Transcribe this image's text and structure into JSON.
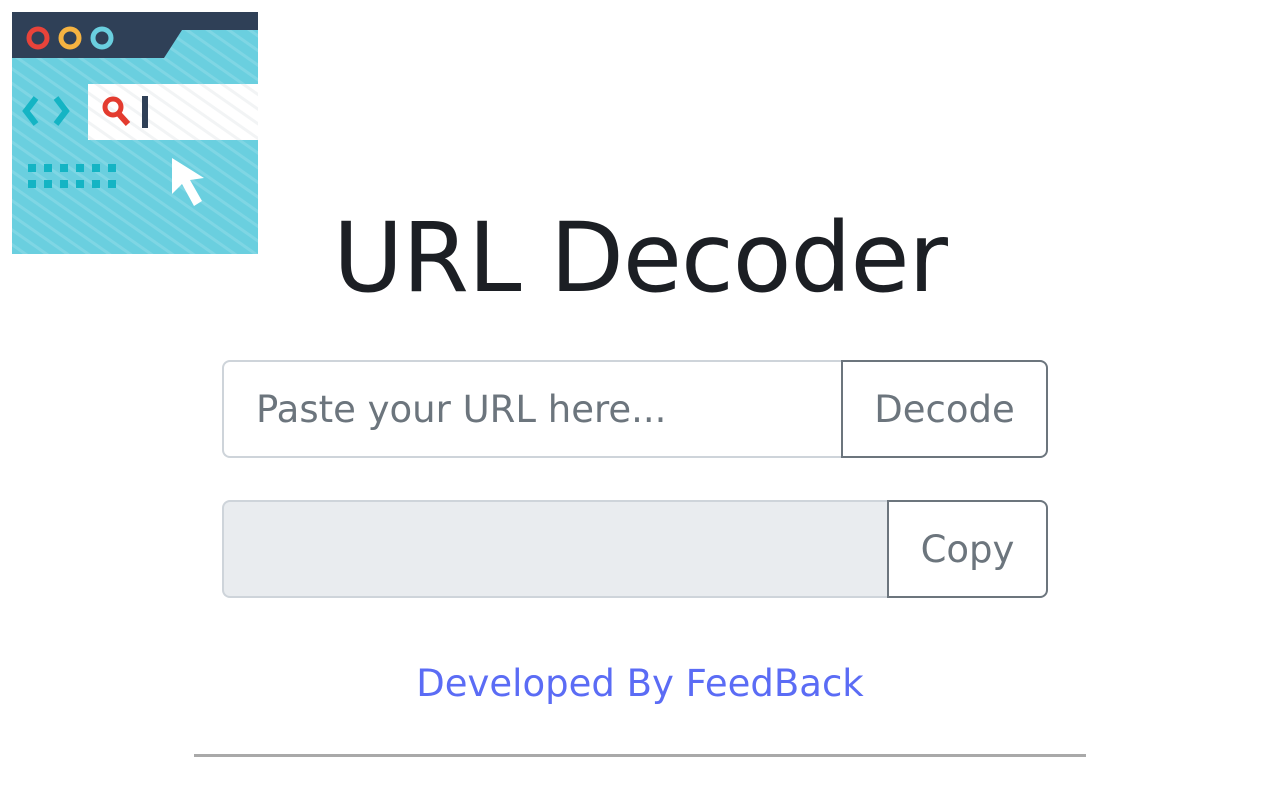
{
  "app": {
    "title": "URL Decoder",
    "logo": {
      "icon": "browser-search-icon",
      "colors": {
        "titlebar": "#2f4057",
        "panel": "#6acfdf",
        "dot_red": "#e8433a",
        "dot_yellow": "#f5b341",
        "dot_teal": "#6acfdf",
        "arrows": "#14b4c4",
        "search_glass": "#e33b2f",
        "cursor_bar": "#2f4057",
        "pointer": "#ffffff"
      }
    }
  },
  "decode_row": {
    "input_placeholder": "Paste your URL here...",
    "input_value": "",
    "button_label": "Decode"
  },
  "output_row": {
    "output_value": "",
    "button_label": "Copy"
  },
  "footer": {
    "link_text": "Developed By FeedBack",
    "link_color": "#5b6cf5"
  }
}
